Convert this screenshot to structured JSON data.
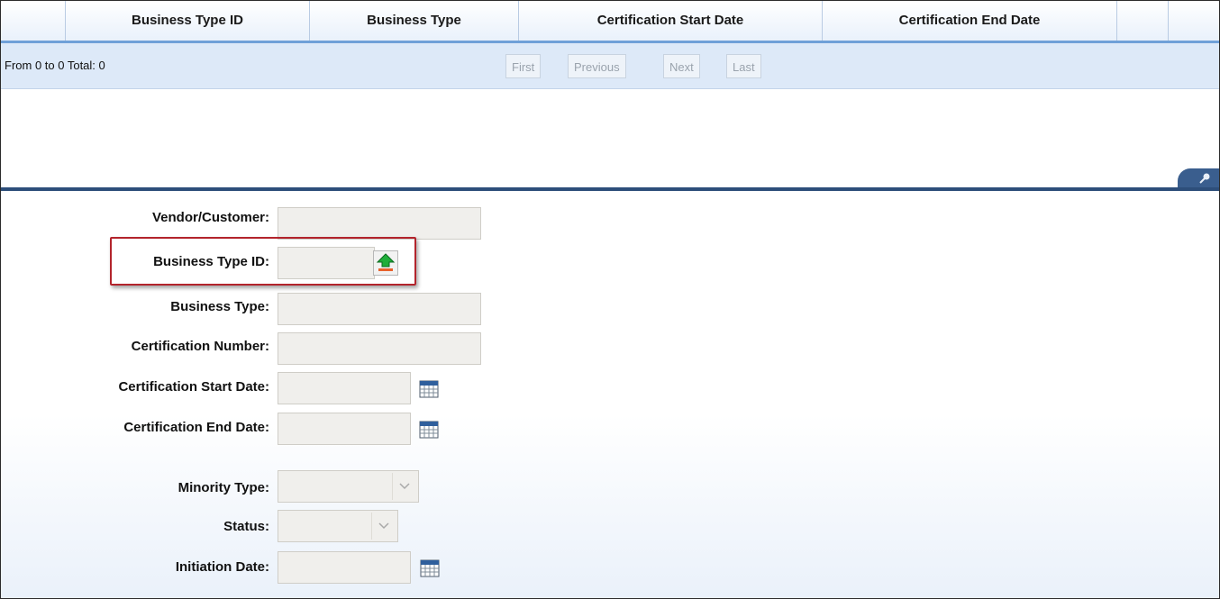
{
  "grid": {
    "columns": [
      "Business Type ID",
      "Business Type",
      "Certification Start Date",
      "Certification End Date"
    ]
  },
  "pager": {
    "info": "From 0 to 0 Total: 0",
    "first": "First",
    "previous": "Previous",
    "next": "Next",
    "last": "Last"
  },
  "form": {
    "vendor_customer_label": "Vendor/Customer:",
    "business_type_id_label": "Business Type ID:",
    "business_type_label": "Business Type:",
    "certification_number_label": "Certification Number:",
    "certification_start_label": "Certification Start Date:",
    "certification_end_label": "Certification End Date:",
    "minority_type_label": "Minority Type:",
    "status_label": "Status:",
    "initiation_date_label": "Initiation Date:"
  },
  "icons": {
    "lookup": "upload-arrow-icon",
    "calendar": "calendar-icon",
    "dropdown": "chevron-down-icon",
    "panel_toggle": "pin-icon"
  },
  "colors": {
    "header_accent": "#6fa0d8",
    "splitter": "#2d4e7a",
    "highlight": "#b3242c"
  }
}
